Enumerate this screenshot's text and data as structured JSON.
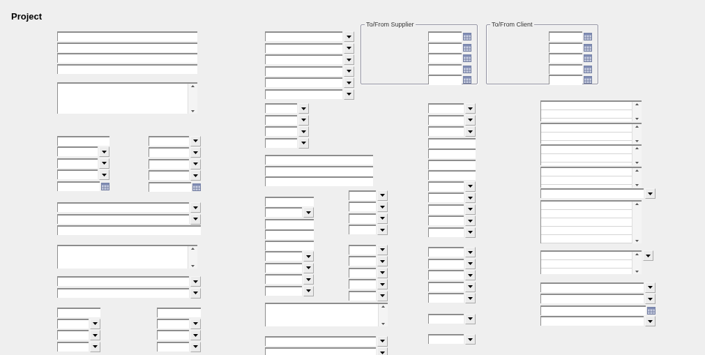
{
  "title": "Project",
  "groups": [
    {
      "fields": [
        {
          "kind": "text"
        },
        {
          "kind": "text"
        },
        {
          "kind": "text"
        },
        {
          "kind": "text"
        }
      ]
    },
    {
      "fields": [
        {
          "kind": "memo"
        }
      ]
    },
    {
      "fields": [
        {
          "kind": "text"
        },
        {
          "kind": "combo"
        },
        {
          "kind": "combo"
        },
        {
          "kind": "combo"
        },
        {
          "kind": "date"
        }
      ]
    },
    {
      "fields": [
        {
          "kind": "combo"
        },
        {
          "kind": "combo"
        },
        {
          "kind": "combo"
        },
        {
          "kind": "combo"
        },
        {
          "kind": "date"
        }
      ]
    },
    {
      "fields": [
        {
          "kind": "combo"
        },
        {
          "kind": "combo"
        },
        {
          "kind": "text"
        }
      ]
    },
    {
      "fields": [
        {
          "kind": "memo"
        }
      ]
    },
    {
      "fields": [
        {
          "kind": "combo"
        },
        {
          "kind": "combo"
        }
      ]
    },
    {
      "fields": [
        {
          "kind": "text"
        },
        {
          "kind": "combo"
        },
        {
          "kind": "combo"
        },
        {
          "kind": "combo"
        }
      ]
    },
    {
      "fields": [
        {
          "kind": "text"
        },
        {
          "kind": "combo"
        },
        {
          "kind": "combo"
        },
        {
          "kind": "combo"
        }
      ]
    },
    {
      "fields": [
        {
          "kind": "combo"
        },
        {
          "kind": "combo"
        },
        {
          "kind": "combo"
        },
        {
          "kind": "combo"
        },
        {
          "kind": "combo"
        },
        {
          "kind": "combo"
        }
      ]
    },
    {
      "fields": [
        {
          "kind": "combo"
        },
        {
          "kind": "combo"
        },
        {
          "kind": "combo"
        },
        {
          "kind": "combo"
        }
      ]
    },
    {
      "fields": [
        {
          "kind": "text"
        },
        {
          "kind": "text"
        },
        {
          "kind": "text"
        }
      ]
    },
    {
      "fields": [
        {
          "kind": "text"
        },
        {
          "kind": "combo"
        },
        {
          "kind": "text"
        },
        {
          "kind": "text"
        },
        {
          "kind": "text"
        },
        {
          "kind": "combo"
        },
        {
          "kind": "combo"
        },
        {
          "kind": "combo"
        },
        {
          "kind": "combo"
        }
      ]
    },
    {
      "fields": [
        {
          "kind": "combo"
        },
        {
          "kind": "combo"
        },
        {
          "kind": "combo"
        },
        {
          "kind": "combo"
        }
      ]
    },
    {
      "fields": [
        {
          "kind": "combo"
        },
        {
          "kind": "combo"
        },
        {
          "kind": "combo"
        },
        {
          "kind": "combo"
        },
        {
          "kind": "combo"
        }
      ]
    },
    {
      "fields": [
        {
          "kind": "memo"
        }
      ]
    },
    {
      "fields": [
        {
          "kind": "combo"
        },
        {
          "kind": "combo"
        }
      ]
    },
    {
      "fields": [
        {
          "kind": "combo"
        },
        {
          "kind": "combo"
        },
        {
          "kind": "combo"
        },
        {
          "kind": "text"
        },
        {
          "kind": "text"
        },
        {
          "kind": "text"
        },
        {
          "kind": "text"
        },
        {
          "kind": "combo"
        }
      ]
    },
    {
      "fields": [
        {
          "kind": "combo"
        },
        {
          "kind": "combo"
        },
        {
          "kind": "combo"
        },
        {
          "kind": "combo"
        }
      ]
    },
    {
      "fields": [
        {
          "kind": "combo"
        },
        {
          "kind": "combo"
        },
        {
          "kind": "combo"
        },
        {
          "kind": "combo"
        },
        {
          "kind": "combo"
        }
      ]
    },
    {
      "fields": [
        {
          "kind": "combo"
        }
      ]
    },
    {
      "fields": [
        {
          "kind": "combo"
        }
      ]
    },
    {
      "fields": [
        {
          "kind": "spin"
        },
        {
          "kind": "spin"
        },
        {
          "kind": "spin"
        },
        {
          "kind": "spin"
        },
        {
          "kind": "combo"
        },
        {
          "kind": "list"
        }
      ]
    },
    {
      "fields": [
        {
          "kind": "spin_combo"
        }
      ]
    },
    {
      "fields": [
        {
          "kind": "combo"
        },
        {
          "kind": "combo"
        },
        {
          "kind": "date"
        },
        {
          "kind": "combo"
        }
      ]
    }
  ],
  "supplier_box": {
    "label": "To/From Supplier",
    "fields": [
      {
        "kind": "date"
      },
      {
        "kind": "date"
      },
      {
        "kind": "date"
      },
      {
        "kind": "date"
      },
      {
        "kind": "date"
      }
    ]
  },
  "client_box": {
    "label": "To/From Client",
    "fields": [
      {
        "kind": "date"
      },
      {
        "kind": "date"
      },
      {
        "kind": "date"
      },
      {
        "kind": "date"
      },
      {
        "kind": "date"
      }
    ]
  }
}
